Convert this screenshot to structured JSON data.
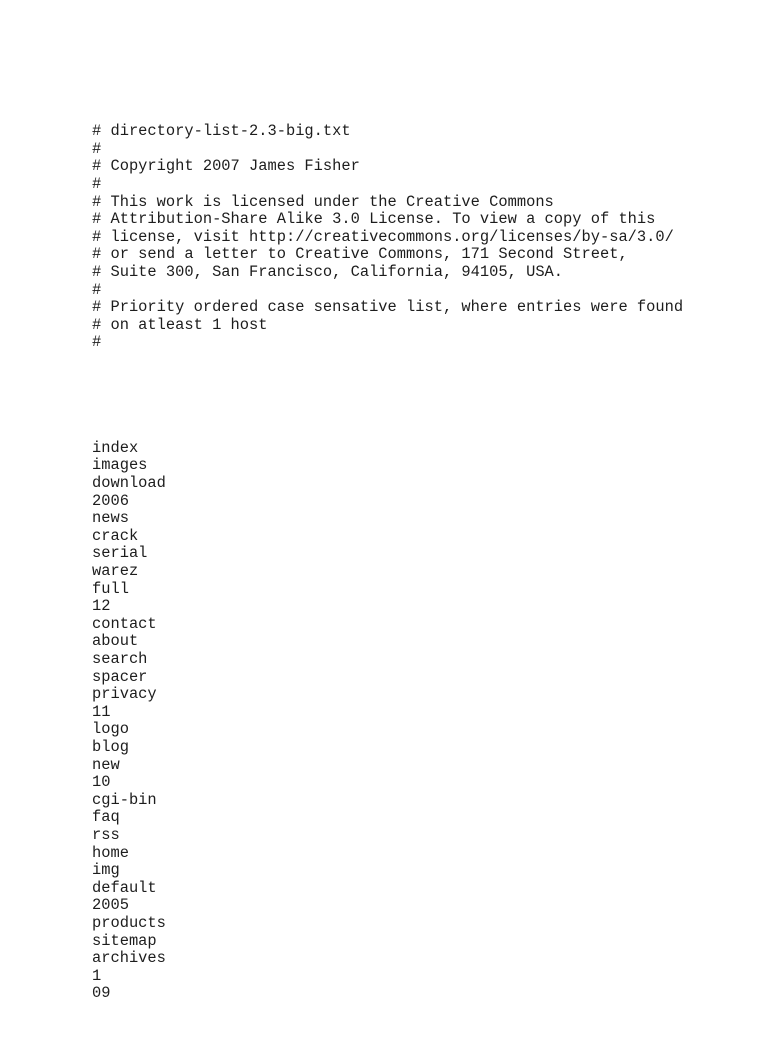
{
  "document": {
    "kind": "plain-text-file-render",
    "filename": "directory-list-2.3-big.txt",
    "background_color": "#ffffff",
    "text_color": "#1d1d1d",
    "header_lines": [
      "# directory-list-2.3-big.txt",
      "#",
      "# Copyright 2007 James Fisher",
      "#",
      "# This work is licensed under the Creative Commons",
      "# Attribution-Share Alike 3.0 License. To view a copy of this",
      "# license, visit http://creativecommons.org/licenses/by-sa/3.0/",
      "# or send a letter to Creative Commons, 171 Second Street,",
      "# Suite 300, San Francisco, California, 94105, USA.",
      "#",
      "# Priority ordered case sensative list, where entries were found",
      "# on atleast 1 host",
      "#"
    ],
    "separator_blank_line": "",
    "entries": [
      "index",
      "images",
      "download",
      "2006",
      "news",
      "crack",
      "serial",
      "warez",
      "full",
      "12",
      "contact",
      "about",
      "search",
      "spacer",
      "privacy",
      "11",
      "logo",
      "blog",
      "new",
      "10",
      "cgi-bin",
      "faq",
      "rss",
      "home",
      "img",
      "default",
      "2005",
      "products",
      "sitemap",
      "archives",
      "1",
      "09"
    ]
  }
}
